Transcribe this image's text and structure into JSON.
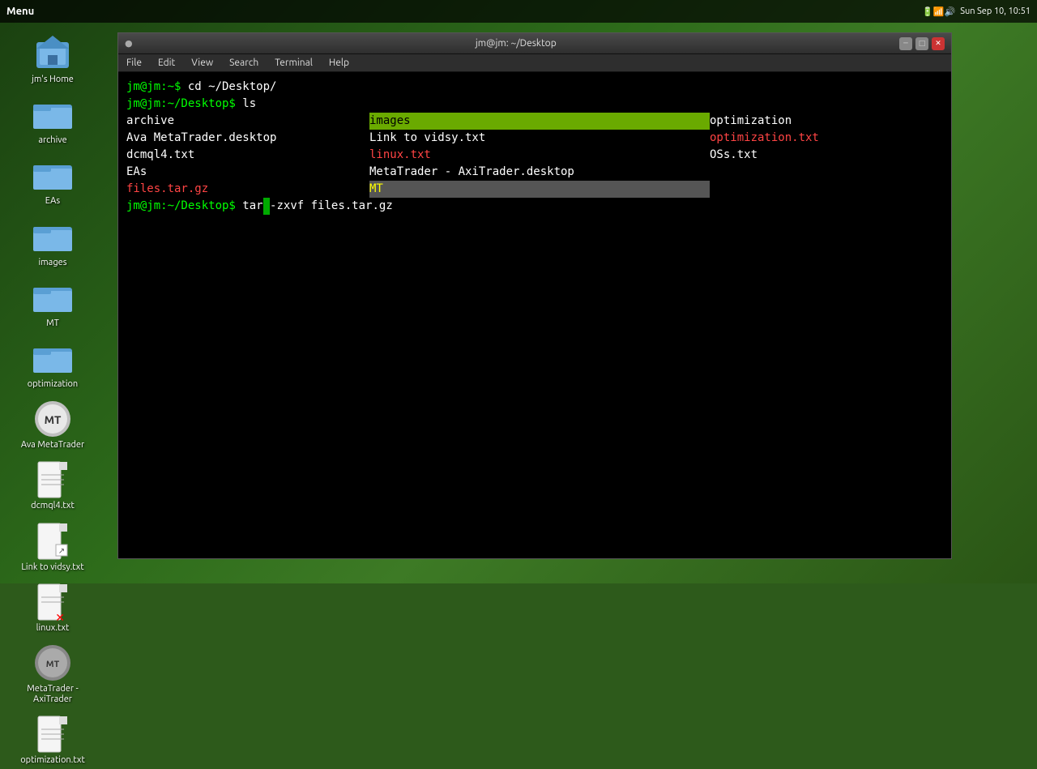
{
  "taskbar": {
    "menu_label": "Menu",
    "right_text": "Sun Sep 10, 10:51"
  },
  "titlebar": {
    "title": "jm@jm: ~/Desktop",
    "dot_color": "#888"
  },
  "terminal_menu": {
    "items": [
      "File",
      "Edit",
      "View",
      "Search",
      "Terminal",
      "Help"
    ]
  },
  "terminal": {
    "lines": [
      {
        "type": "cmd",
        "prompt": "jm@jm:~$ ",
        "text": "cd ~/Desktop/"
      },
      {
        "type": "cmd",
        "prompt": "jm@jm:~/Desktop$ ",
        "text": "ls"
      },
      {
        "type": "ls"
      },
      {
        "type": "cmd_cursor",
        "prompt": "jm@jm:~/Desktop$ ",
        "before_cursor": "tar",
        "cursor": " ",
        "after_cursor": "-zxvf files.tar.gz"
      }
    ],
    "ls_col1": [
      "archive",
      "Ava MetaTrader.desktop",
      "dcmql4.txt",
      "EAs",
      "files.tar.gz"
    ],
    "ls_col2": [
      "images",
      "Link to vidsy.txt",
      "linux.txt",
      "MetaTrader - AxiTrader.desktop",
      "MT"
    ],
    "ls_col3": [
      "optimization",
      "optimization.txt",
      "OSs.txt"
    ]
  },
  "desktop_icons": [
    {
      "id": "jms-home",
      "label": "jm's Home",
      "type": "home"
    },
    {
      "id": "archive",
      "label": "archive",
      "type": "folder"
    },
    {
      "id": "eas",
      "label": "EAs",
      "type": "folder"
    },
    {
      "id": "images",
      "label": "images",
      "type": "folder"
    },
    {
      "id": "mt",
      "label": "MT",
      "type": "folder"
    },
    {
      "id": "optimization",
      "label": "optimization",
      "type": "folder"
    },
    {
      "id": "ava-metatrader",
      "label": "Ava MetaTrader",
      "type": "app"
    },
    {
      "id": "dcmql4",
      "label": "dcmql4.txt",
      "type": "file"
    },
    {
      "id": "link-vidsy",
      "label": "Link to vidsy.txt",
      "type": "link"
    },
    {
      "id": "linux-txt",
      "label": "linux.txt",
      "type": "file-broken"
    },
    {
      "id": "metatrader-axitrader",
      "label": "MetaTrader - AxiTrader",
      "type": "app"
    },
    {
      "id": "optimization-txt",
      "label": "optimization.txt",
      "type": "file"
    }
  ]
}
